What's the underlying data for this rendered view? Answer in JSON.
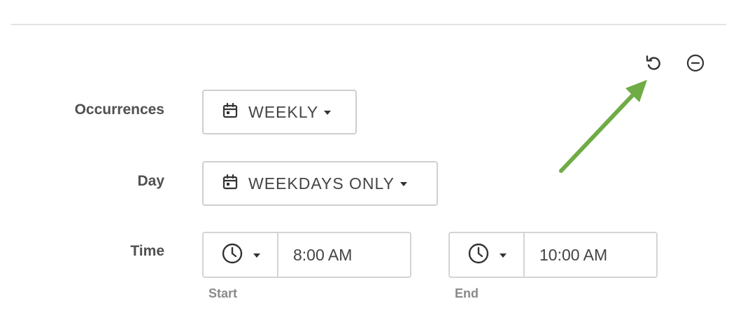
{
  "header": {
    "reset_icon": "undo-icon",
    "remove_icon": "minus-circle-icon"
  },
  "annotation": {
    "arrow_color": "#6fac45"
  },
  "occurrences": {
    "label": "Occurrences",
    "icon": "calendar-icon",
    "value": "WEEKLY"
  },
  "day": {
    "label": "Day",
    "icon": "calendar-icon",
    "value": "WEEKDAYS ONLY"
  },
  "time": {
    "label": "Time",
    "start": {
      "icon": "clock-icon",
      "value": "8:00 AM",
      "help": "Start"
    },
    "end": {
      "icon": "clock-icon",
      "value": "10:00 AM",
      "help": "End"
    }
  }
}
